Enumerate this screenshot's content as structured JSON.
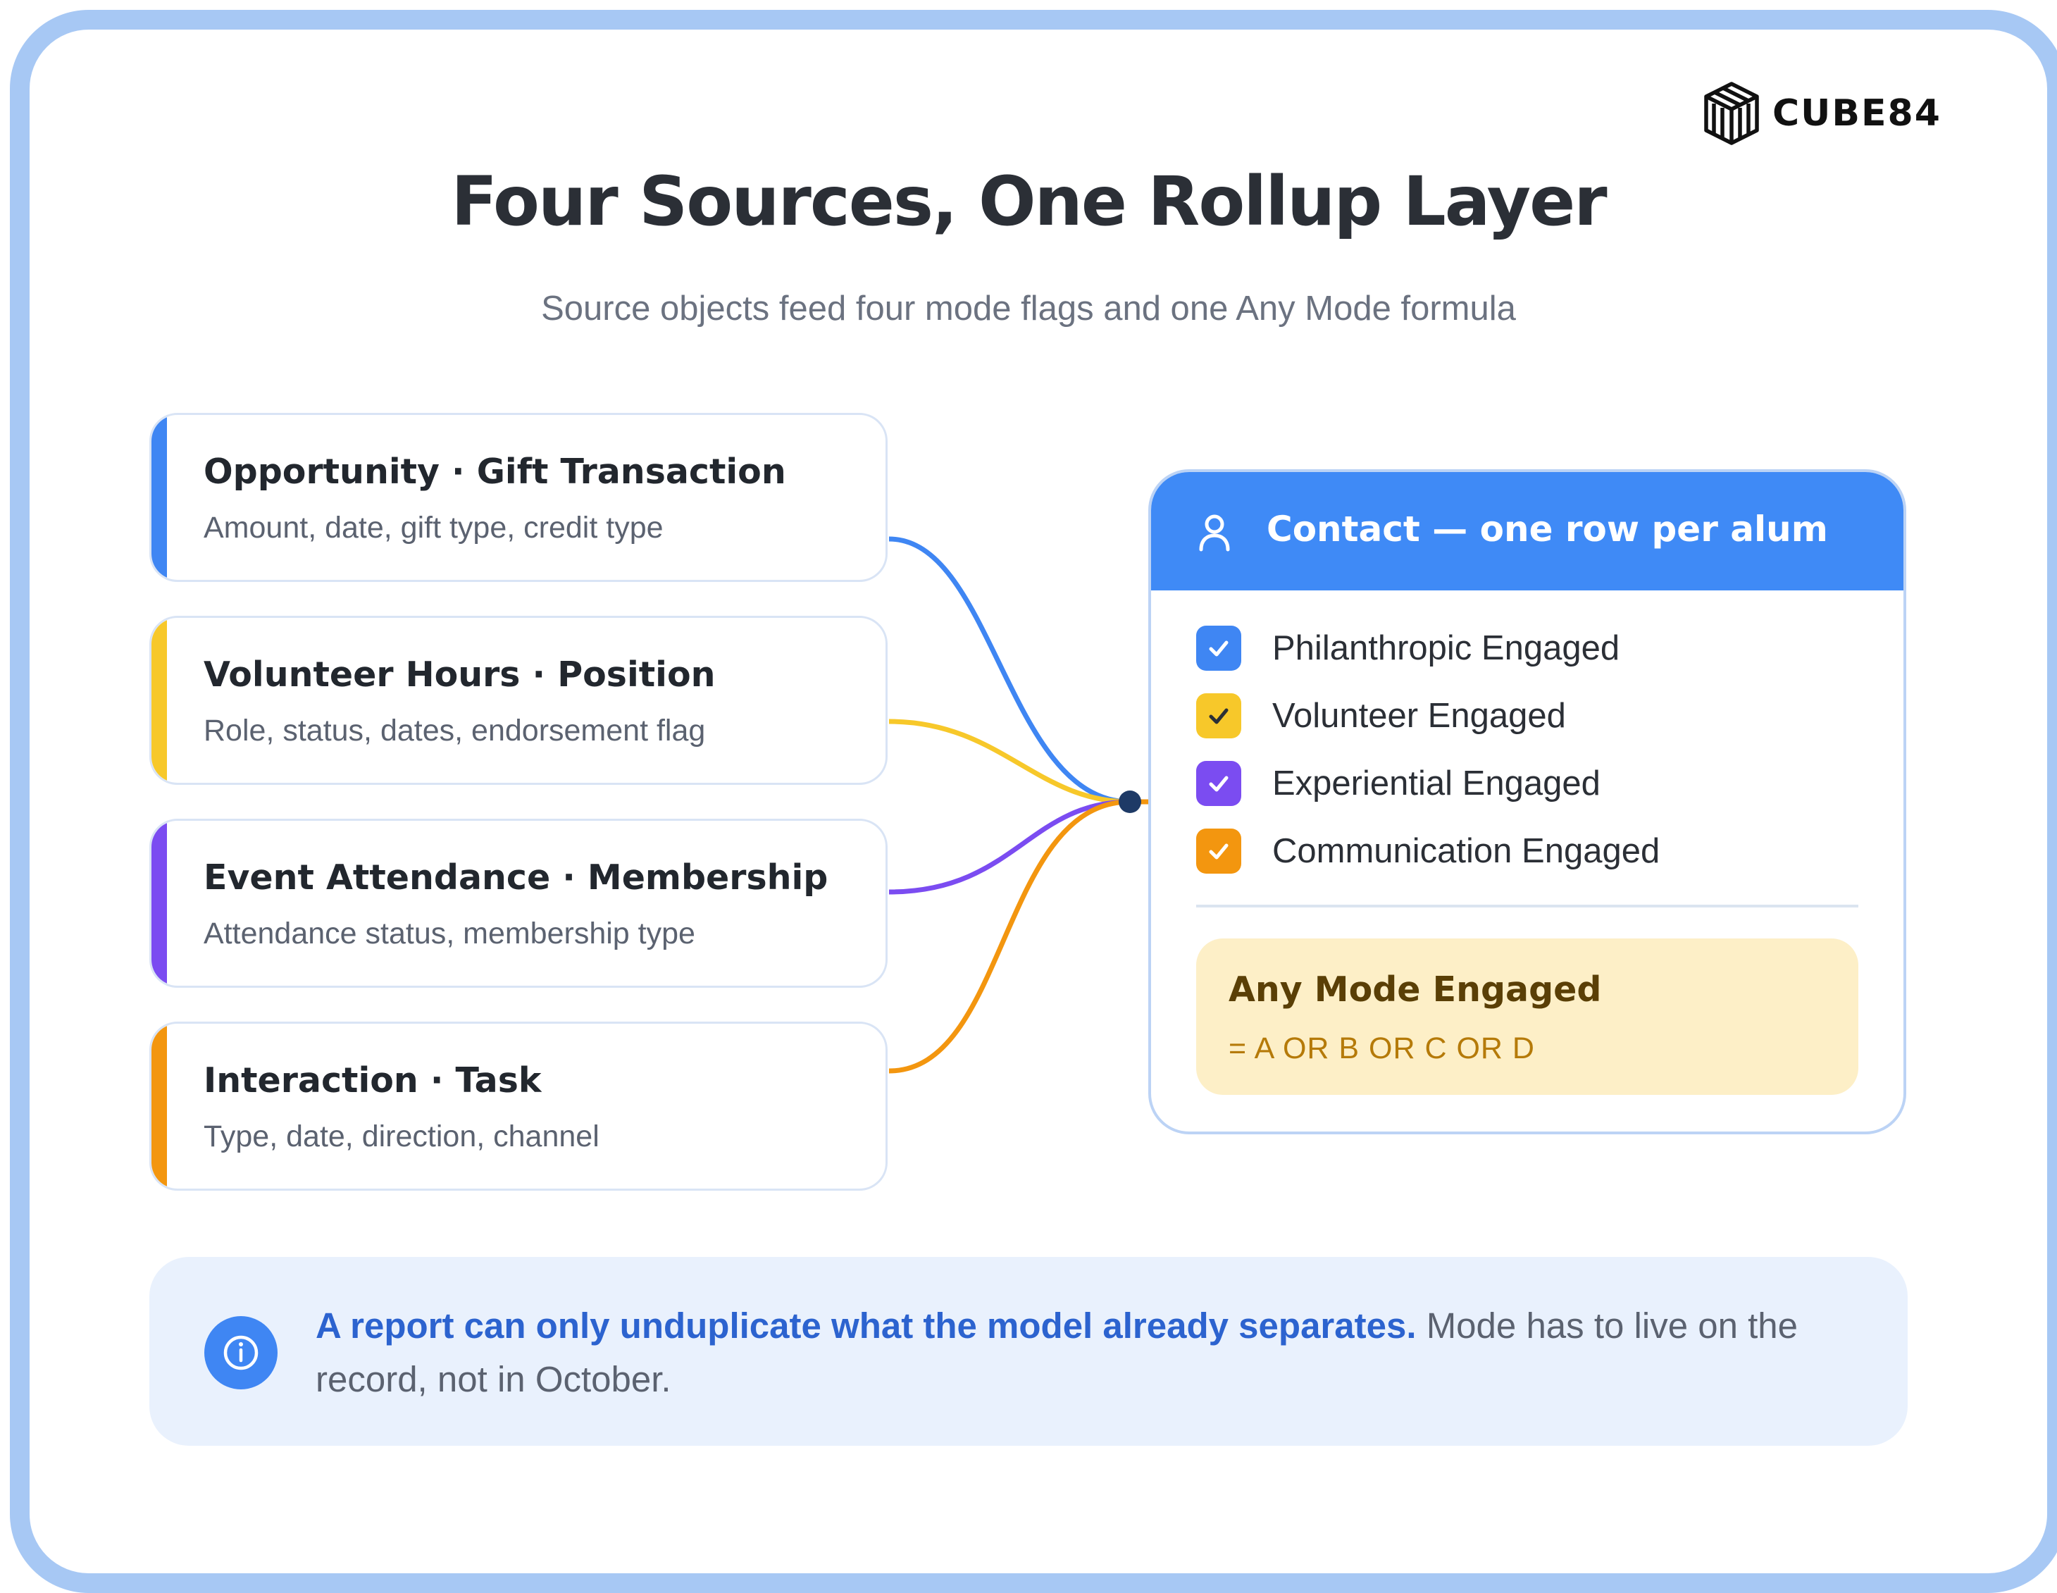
{
  "brand": {
    "name": "CUBE84",
    "icon": "cube-logo-icon"
  },
  "title": "Four Sources, One Rollup Layer",
  "subtitle": "Source objects feed four mode flags and one Any Mode formula",
  "sources": [
    {
      "title": "Opportunity · Gift Transaction",
      "detail": "Amount, date, gift type, credit type",
      "color": "#3f86f3"
    },
    {
      "title": "Volunteer Hours · Position",
      "detail": "Role, status, dates, endorsement flag",
      "color": "#f7c82a"
    },
    {
      "title": "Event Attendance · Membership",
      "detail": "Attendance status, membership type",
      "color": "#7b4cf1"
    },
    {
      "title": "Interaction · Task",
      "detail": "Type, date, direction, channel",
      "color": "#f3960f"
    }
  ],
  "contact": {
    "header": "Contact — one row per alum",
    "header_icon": "user-icon",
    "header_color": "#3f8af6",
    "flags": [
      {
        "label": "Philanthropic Engaged",
        "color": "#3f86f3",
        "icon": "check-icon"
      },
      {
        "label": "Volunteer Engaged",
        "color": "#f7c82a",
        "icon": "check-icon"
      },
      {
        "label": "Experiential Engaged",
        "color": "#7b4cf1",
        "icon": "check-icon"
      },
      {
        "label": "Communication Engaged",
        "color": "#f3960f",
        "icon": "check-icon"
      }
    ],
    "any_mode": {
      "title": "Any Mode Engaged",
      "formula": "= A OR B OR C OR D"
    }
  },
  "hub_color": "#1e3a66",
  "callout": {
    "icon": "info-icon",
    "emphasis": "A report can only unduplicate what the model already separates.",
    "text": " Mode has to live on the record, not in October."
  }
}
